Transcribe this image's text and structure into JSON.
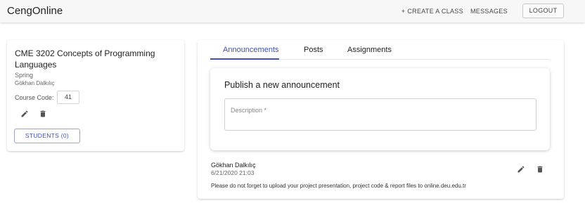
{
  "appbar": {
    "brand": "CengOnline",
    "create_class": "+ CREATE A CLASS",
    "messages": "MESSAGES",
    "logout": "LOGOUT"
  },
  "course": {
    "title": "CME 3202 Concepts of Programming Languages",
    "term": "Spring",
    "teacher": "Gökhan Dalkılıç",
    "code_label": "Course Code:",
    "code_value": "41",
    "students_button": "STUDENTS (0)",
    "icons": [
      "pencil-icon",
      "trash-icon"
    ]
  },
  "tabs": [
    {
      "label": "Announcements",
      "active": true
    },
    {
      "label": "Posts",
      "active": false
    },
    {
      "label": "Assignments",
      "active": false
    }
  ],
  "publish": {
    "title": "Publish a new announcement",
    "description_placeholder": "Description *"
  },
  "announcements": [
    {
      "author": "Gökhan Dalkılıç",
      "date": "6/21/2020 21:03",
      "body": "Please do not forget to upload your project presentation, project code & report files to online.deu.edu.tr"
    }
  ],
  "colors": {
    "accent": "#3f51b5",
    "appbar_bg": "#f7f7f7"
  }
}
